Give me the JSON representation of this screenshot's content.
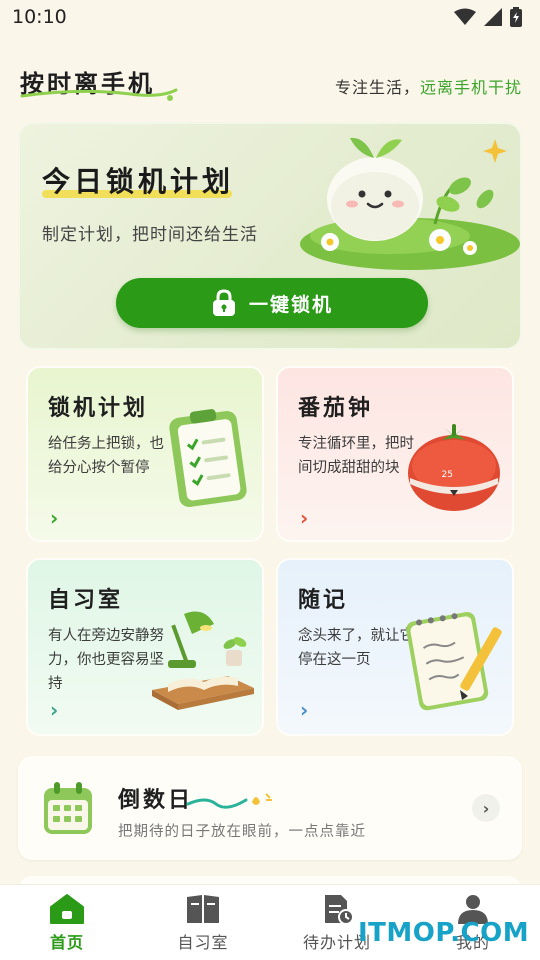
{
  "status_bar": {
    "time": "10:10"
  },
  "header": {
    "brand": "按时离手机",
    "slogan_part1": "专注生活，",
    "slogan_part2": "远离手机干扰"
  },
  "hero": {
    "title": "今日锁机计划",
    "subtitle": "制定计划，把时间还给生活",
    "button_label": "一键锁机"
  },
  "cards": [
    {
      "title": "锁机计划",
      "desc": "给任务上把锁，也给分心按个暂停",
      "arrow": "›",
      "accent": "#3aa52a"
    },
    {
      "title": "番茄钟",
      "desc": "专注循环里，把时间切成甜甜的块",
      "arrow": "›",
      "accent": "#e0553c",
      "timer_text": "25"
    },
    {
      "title": "自习室",
      "desc": "有人在旁边安静努力，你也更容易坚持",
      "arrow": "›",
      "accent": "#3aa58a"
    },
    {
      "title": "随记",
      "desc": "念头来了，就让它停在这一页",
      "arrow": "›",
      "accent": "#4a90c8"
    }
  ],
  "countdown": {
    "title": "倒数日",
    "subtitle": "把期待的日子放在眼前，一点点靠近",
    "arrow": "›"
  },
  "tabbar": {
    "items": [
      {
        "label": "首页",
        "icon": "home-icon",
        "active": true
      },
      {
        "label": "自习室",
        "icon": "book-icon",
        "active": false
      },
      {
        "label": "待办计划",
        "icon": "todo-doc-icon",
        "active": false
      },
      {
        "label": "我的",
        "icon": "user-icon",
        "active": false
      }
    ]
  },
  "watermark": "ITMOP.COM",
  "colors": {
    "accent": "#2a9a17",
    "background": "#fbf6ea",
    "slogan_green": "#3aa52a"
  }
}
